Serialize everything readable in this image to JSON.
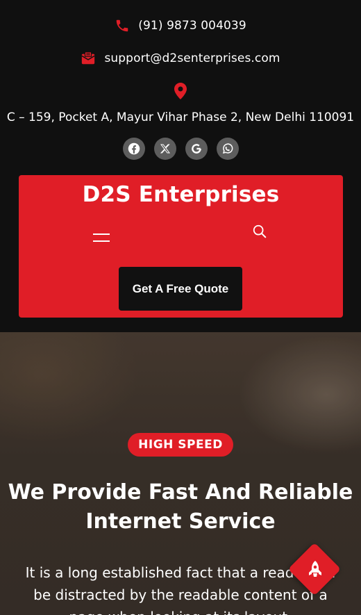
{
  "contact": {
    "phone": "(91) 9873 004039",
    "email": "support@d2senterprises.com",
    "address": "C – 159, Pocket A, Mayur Vihar Phase 2, New Delhi 110091"
  },
  "social": [
    "facebook-icon",
    "x-icon",
    "google-icon",
    "whatsapp-icon"
  ],
  "header": {
    "brand": "D2S Enterprises",
    "cta_label": "Get A Free Quote"
  },
  "hero": {
    "badge": "HIGH SPEED",
    "title": "We Provide Fast And Reliable Internet Service",
    "text": "It is a long established fact that a reader will be distracted by the readable content of a page when looking at its layout."
  },
  "colors": {
    "accent": "#e01e27",
    "background": "#101010"
  }
}
